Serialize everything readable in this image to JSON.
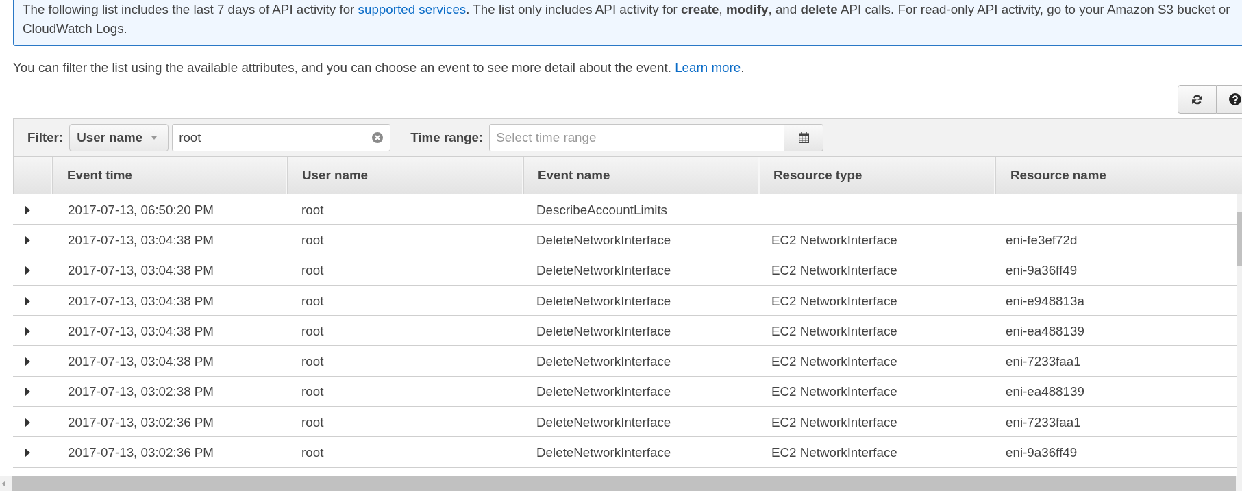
{
  "notice": {
    "text_before": "The following list includes the last 7 days of API activity for ",
    "link": "supported services",
    "text_after": ". The list only includes API activity for **create**, **modify**, and **delete** API calls. For read-only API activity, go to your Amazon S3 bucket or CloudWatch Logs."
  },
  "intro": {
    "text_before": "You can filter the list using the available attributes, and you can choose an event to see more detail about the event. ",
    "link": "Learn more",
    "text_after": "."
  },
  "toolbar": {
    "buttons": [
      {
        "kind": "refresh"
      },
      {
        "kind": "help"
      }
    ]
  },
  "filter": {
    "label": "Filter:",
    "attribute": "User name",
    "value": "root",
    "time_range": {
      "label": "Time range:",
      "placeholder": "Select time range"
    }
  },
  "table": {
    "columns": [
      "Event time",
      "User name",
      "Event name",
      "Resource type",
      "Resource name"
    ],
    "rows": [
      {
        "expanded": false,
        "event_time": "2017-07-13, 06:50:20 PM",
        "user_name": "root",
        "event_name": "DescribeAccountLimits"
      },
      {
        "expanded": false,
        "event_time": "2017-07-13, 03:04:38 PM",
        "user_name": "root",
        "event_name": "DeleteNetworkInterface",
        "resource_type": "EC2 NetworkInterface",
        "resource_name": "eni-fe3ef72d"
      },
      {
        "expanded": false,
        "event_time": "2017-07-13, 03:04:38 PM",
        "user_name": "root",
        "event_name": "DeleteNetworkInterface",
        "resource_type": "EC2 NetworkInterface",
        "resource_name": "eni-9a36ff49"
      },
      {
        "expanded": false,
        "event_time": "2017-07-13, 03:04:38 PM",
        "user_name": "root",
        "event_name": "DeleteNetworkInterface",
        "resource_type": "EC2 NetworkInterface",
        "resource_name": "eni-e948813a"
      },
      {
        "expanded": false,
        "event_time": "2017-07-13, 03:04:38 PM",
        "user_name": "root",
        "event_name": "DeleteNetworkInterface",
        "resource_type": "EC2 NetworkInterface",
        "resource_name": "eni-ea488139"
      },
      {
        "expanded": false,
        "event_time": "2017-07-13, 03:04:38 PM",
        "user_name": "root",
        "event_name": "DeleteNetworkInterface",
        "resource_type": "EC2 NetworkInterface",
        "resource_name": "eni-7233faa1"
      },
      {
        "expanded": false,
        "event_time": "2017-07-13, 03:02:38 PM",
        "user_name": "root",
        "event_name": "DeleteNetworkInterface",
        "resource_type": "EC2 NetworkInterface",
        "resource_name": "eni-ea488139"
      },
      {
        "expanded": false,
        "event_time": "2017-07-13, 03:02:36 PM",
        "user_name": "root",
        "event_name": "DeleteNetworkInterface",
        "resource_type": "EC2 NetworkInterface",
        "resource_name": "eni-7233faa1"
      },
      {
        "expanded": false,
        "event_time": "2017-07-13, 03:02:36 PM",
        "user_name": "root",
        "event_name": "DeleteNetworkInterface",
        "resource_type": "EC2 NetworkInterface",
        "resource_name": "eni-9a36ff49"
      }
    ]
  }
}
